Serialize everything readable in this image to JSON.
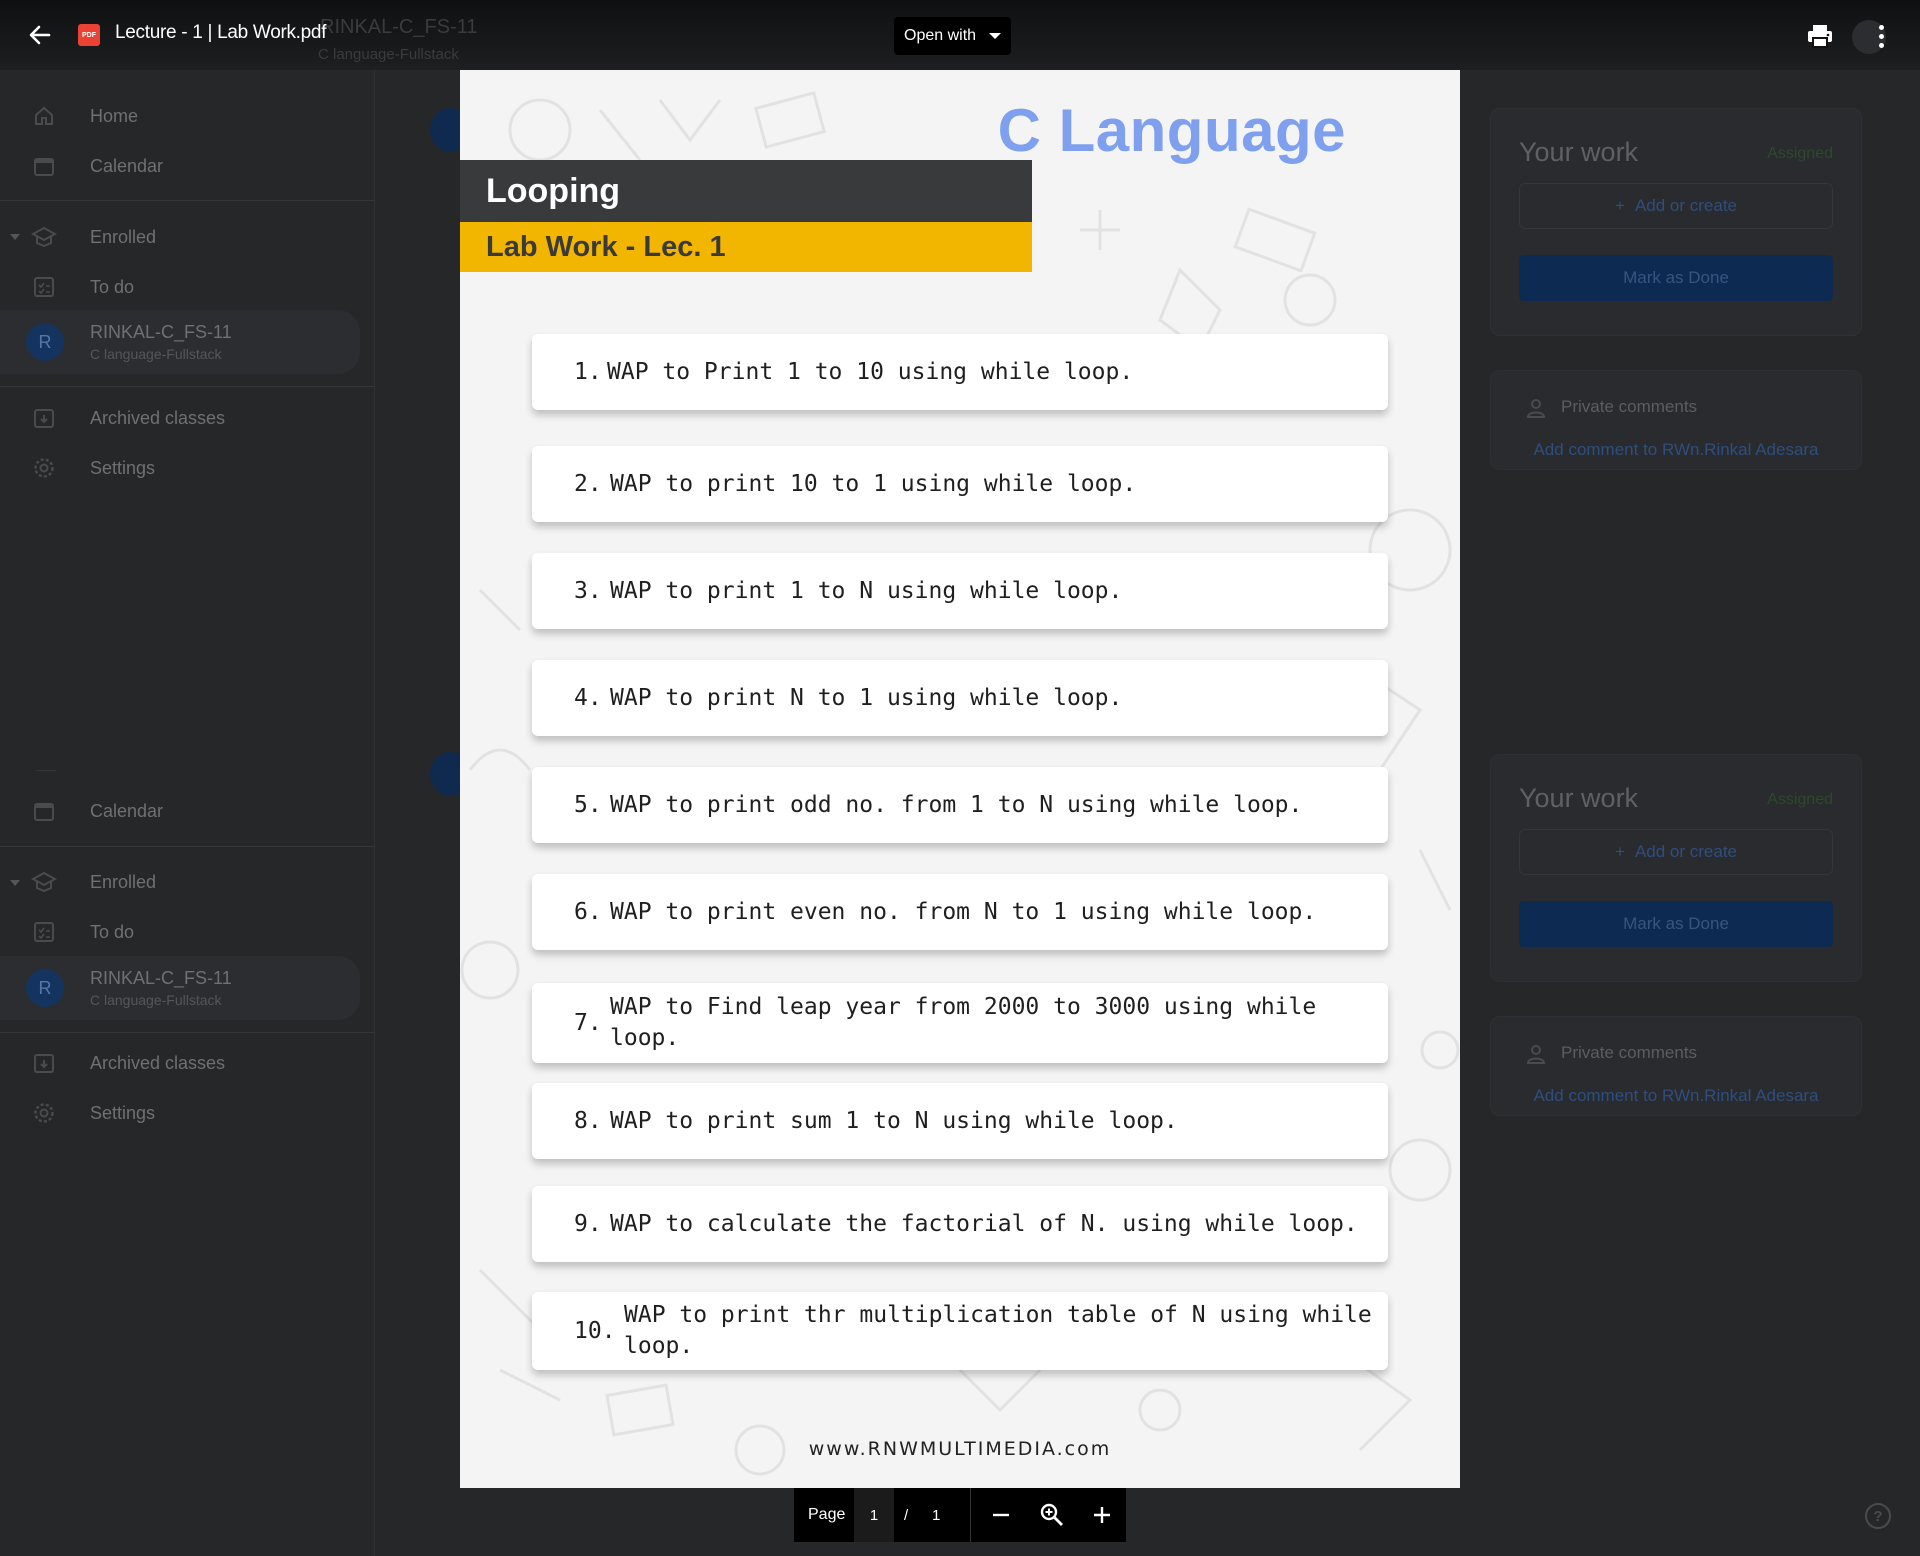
{
  "viewer": {
    "file_title": "Lecture - 1 | Lab Work.pdf",
    "open_with": "Open with",
    "file_type_badge": "PDF"
  },
  "background": {
    "class_title": "RINKAL-C_FS-11",
    "class_subtitle": "C language-Fullstack",
    "sidebar": {
      "home": "Home",
      "calendar": "Calendar",
      "enrolled": "Enrolled",
      "todo": "To do",
      "class_name": "RINKAL-C_FS-11",
      "class_sub": "C language-Fullstack",
      "class_initial": "R",
      "archived": "Archived classes",
      "settings": "Settings"
    },
    "work_card": {
      "title": "Your work",
      "status": "Assigned",
      "add": "Add or create",
      "mark_done": "Mark as Done"
    },
    "comments_card": {
      "title": "Private comments",
      "link": "Add comment to RWn.Rinkal Adesara"
    }
  },
  "document": {
    "title": "C Language",
    "topic": "Looping",
    "subtitle": "Lab Work - Lec. 1",
    "tasks": [
      {
        "num": "1.",
        "text": "WAP to Print 1 to 10 using while loop."
      },
      {
        "num": "2.",
        "text": "WAP to print 10 to 1 using while loop."
      },
      {
        "num": "3.",
        "text": "WAP to print 1 to N using while loop."
      },
      {
        "num": "4.",
        "text": "WAP to print N to 1 using while loop."
      },
      {
        "num": "5.",
        "text": "WAP to print odd no. from 1 to N using while loop."
      },
      {
        "num": "6.",
        "text": "WAP to print even no. from N to 1 using while loop."
      },
      {
        "num": "7.",
        "text": "WAP to Find leap year from 2000 to 3000 using while loop."
      },
      {
        "num": "8.",
        "text": "WAP to print sum 1 to N using while loop."
      },
      {
        "num": "9.",
        "text": "WAP to calculate the factorial of N. using while loop."
      },
      {
        "num": "10.",
        "text": "WAP to print thr multiplication table of N using while loop."
      }
    ],
    "website": "www.RNWMULTIMEDIA.com"
  },
  "pagebar": {
    "label": "Page",
    "current": "1",
    "separator": "/",
    "total": "1"
  },
  "help_label": "?",
  "colors": {
    "title_blue": "#7ea0ee",
    "header_dark": "#393a3b",
    "header_yellow": "#f2b500"
  }
}
